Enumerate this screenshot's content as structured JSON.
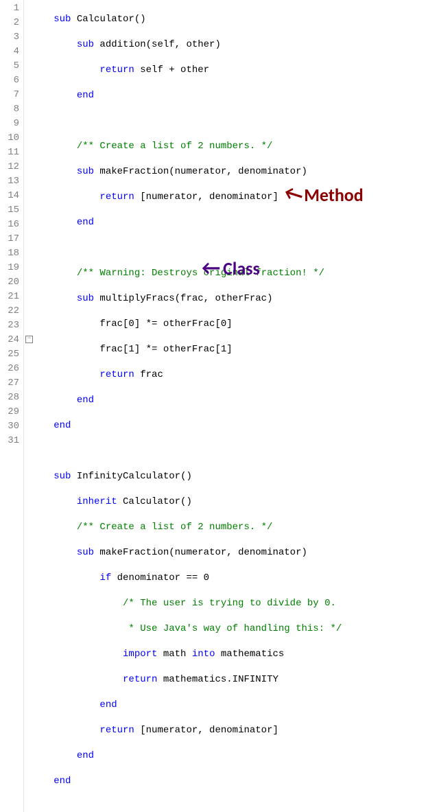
{
  "lines": {
    "l1_kw": "sub",
    "l1_txt": " Calculator()",
    "l2_kw": "sub",
    "l2_txt": " addition(self, other)",
    "l3_kw": "return",
    "l3_txt": " self + other",
    "l4_kw": "end",
    "l6_cm": "/** Create a list of 2 numbers. */",
    "l7_kw": "sub",
    "l7_txt": " makeFraction(numerator, denominator)",
    "l8_kw": "return",
    "l8_txt": " [numerator, denominator]",
    "l9_kw": "end",
    "l11_cm": "/** Warning: Destroys original fraction! */",
    "l12_kw": "sub",
    "l12_txt": " multiplyFracs(frac, otherFrac)",
    "l13_txt": "frac[0] *= otherFrac[0]",
    "l14_txt": "frac[1] *= otherFrac[1]",
    "l15_kw": "return",
    "l15_txt": " frac",
    "l16_kw": "end",
    "l17_kw": "end",
    "l19_kw": "sub",
    "l19_txt": " InfinityCalculator()",
    "l20_kw": "inherit",
    "l20_txt": " Calculator()",
    "l21_cm": "/** Create a list of 2 numbers. */",
    "l22_kw": "sub",
    "l22_txt": " makeFraction(numerator, denominator)",
    "l23_kw": "if",
    "l23_txt": " denominator == 0",
    "l24_cm": "/* The user is trying to divide by 0.",
    "l25_cm": " * Use Java's way of handling this: */",
    "l26_kw1": "import",
    "l26_txt1": " math ",
    "l26_kw2": "into",
    "l26_txt2": " mathematics",
    "l27_kw": "return",
    "l27_txt": " mathematics.INFINITY",
    "l28_kw": "end",
    "l29_kw": "return",
    "l29_txt": " [numerator, denominator]",
    "l30_kw": "end",
    "l31_kw": "end"
  },
  "annotations": {
    "method": "Method",
    "class": "Class"
  },
  "line_numbers": [
    "1",
    "2",
    "3",
    "4",
    "5",
    "6",
    "7",
    "8",
    "9",
    "10",
    "11",
    "12",
    "13",
    "14",
    "15",
    "16",
    "17",
    "18",
    "19",
    "20",
    "21",
    "22",
    "23",
    "24",
    "25",
    "26",
    "27",
    "28",
    "29",
    "30",
    "31"
  ]
}
